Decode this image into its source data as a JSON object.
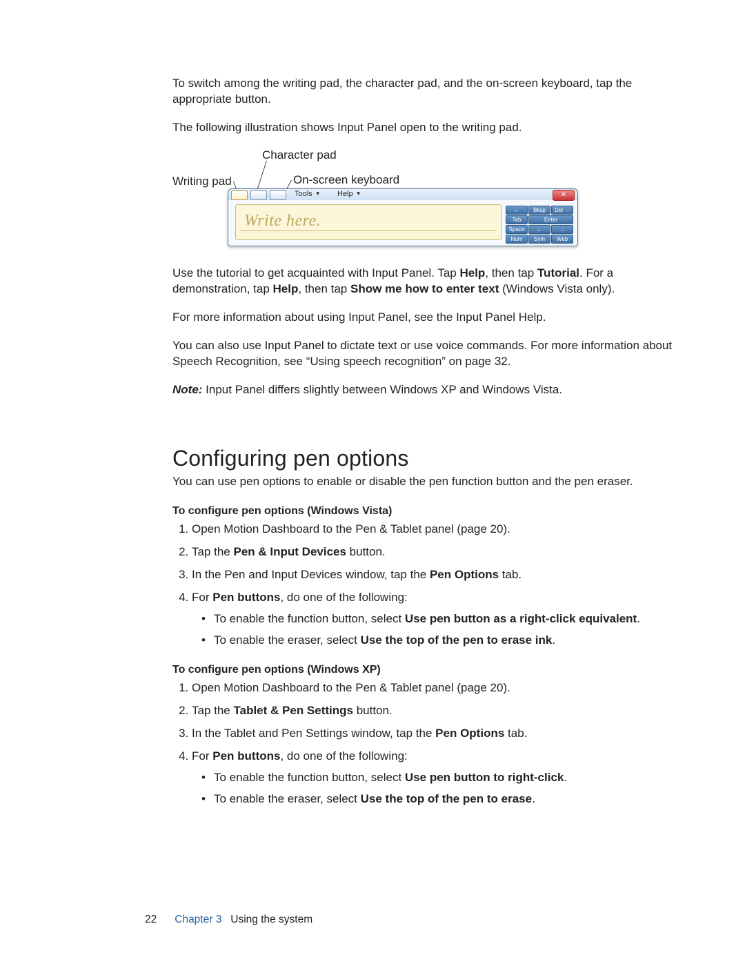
{
  "para1": "To switch among the writing pad, the character pad, and the on-screen keyboard, tap the appropriate button.",
  "para2": "The following illustration shows Input Panel open to the writing pad.",
  "callouts": {
    "writing_pad": "Writing pad",
    "character_pad": "Character pad",
    "on_screen_keyboard": "On-screen keyboard"
  },
  "panel": {
    "tools": "Tools",
    "help": "Help",
    "close": "✕",
    "write_here": "Write here.",
    "keys": {
      "bksp_l": "←",
      "bksp": "Bksp",
      "del": "Del",
      "del_r": "→",
      "tab": "Tab",
      "enter": "Enter",
      "space": "Space",
      "left": "←",
      "right": "→",
      "num": "Num",
      "sym": "Sym",
      "web": "Web"
    }
  },
  "para3a": "Use the tutorial to get acquainted with Input Panel. Tap ",
  "b_help": "Help",
  "para3b": ", then tap ",
  "b_tutorial": "Tutorial",
  "para3c": ". For a demonstration, tap ",
  "para3d": ", then tap ",
  "b_show": "Show me how to enter text",
  "para3e": " (Windows Vista only).",
  "para4": "For more information about using Input Panel, see the Input Panel Help.",
  "para5": "You can also use Input Panel to dictate text or use voice commands. For more information about Speech Recognition, see “Using speech recognition” on page 32.",
  "note_label": "Note:",
  "note_text": " Input Panel differs slightly between Windows XP and Windows Vista.",
  "h1": "Configuring pen options",
  "h1_sub": "You can use pen options to enable or disable the pen function button and the pen eraser.",
  "vista_head": "To configure pen options (Windows Vista)",
  "v1": "Open Motion Dashboard to the Pen & Tablet panel (page 20).",
  "v2a": "Tap the ",
  "v2b": "Pen & Input Devices",
  "v2c": " button.",
  "v3a": "In the Pen and Input Devices window, tap the ",
  "v3b": "Pen Options",
  "v3c": " tab.",
  "v4a": "For ",
  "v4b": "Pen buttons",
  "v4c": ", do one of the following:",
  "v_b1a": "To enable the function button, select ",
  "v_b1b": "Use pen button as a right-click equivalent",
  "v_b1c": ".",
  "v_b2a": "To enable the eraser, select ",
  "v_b2b": "Use the top of the pen to erase ink",
  "v_b2c": ".",
  "xp_head": "To configure pen options (Windows XP)",
  "x1": "Open Motion Dashboard to the Pen & Tablet panel (page 20).",
  "x2a": "Tap the ",
  "x2b": "Tablet & Pen Settings",
  "x2c": " button.",
  "x3a": "In the Tablet and Pen Settings window, tap the ",
  "x3b": "Pen Options",
  "x3c": " tab.",
  "x4a": "For ",
  "x4b": "Pen buttons",
  "x4c": ", do one of the following:",
  "x_b1a": "To enable the function button, select ",
  "x_b1b": "Use pen button to right-click",
  "x_b1c": ".",
  "x_b2a": "To enable the eraser, select ",
  "x_b2b": "Use the top of the pen to erase",
  "x_b2c": ".",
  "footer": {
    "page": "22",
    "chapter": "Chapter 3",
    "title": "Using the system"
  }
}
